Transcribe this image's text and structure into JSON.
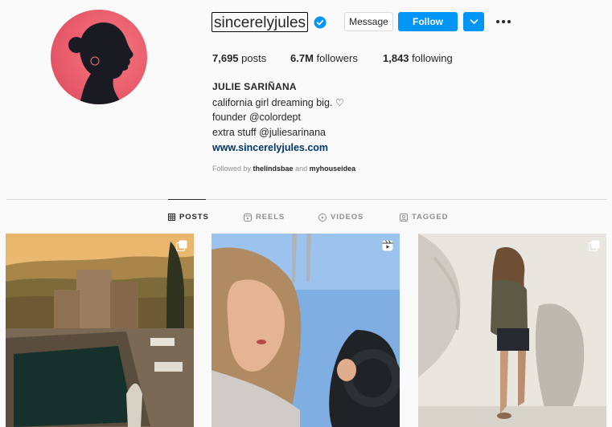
{
  "profile": {
    "username": "sincerelyjules",
    "verified_icon": "verified-badge-icon",
    "buttons": {
      "message": "Message",
      "follow": "Follow"
    },
    "stats": {
      "posts_count": "7,695",
      "posts_label": "posts",
      "followers_count": "6.7M",
      "followers_label": "followers",
      "following_count": "1,843",
      "following_label": "following"
    },
    "full_name": "JULIE SARIÑANA",
    "bio": [
      "california girl dreaming big. ♡",
      "founder @colordept",
      "extra stuff @juliesarinana"
    ],
    "link": "www.sincerelyjules.com",
    "followed_by": {
      "prefix": "Followed by",
      "user1": "thelindsbae",
      "joiner": "and",
      "user2": "myhouseidea"
    }
  },
  "tabs": [
    {
      "label": "POSTS",
      "icon": "grid-icon",
      "active": true
    },
    {
      "label": "REELS",
      "icon": "reels-icon",
      "active": false
    },
    {
      "label": "VIDEOS",
      "icon": "play-icon",
      "active": false
    },
    {
      "label": "TAGGED",
      "icon": "tag-icon",
      "active": false
    }
  ],
  "posts": [
    {
      "type": "carousel",
      "badge_icon": "carousel-icon",
      "scene": "chateau with pool at sunset"
    },
    {
      "type": "reel",
      "badge_icon": "reel-icon",
      "scene": "woman applying lipstick in convertible"
    },
    {
      "type": "carousel",
      "badge_icon": "carousel-icon",
      "scene": "woman against white wall with shadows"
    }
  ],
  "colors": {
    "accent": "#0095f6",
    "link": "#00376b",
    "background": "#fafafa",
    "muted": "#8e8e8e"
  }
}
